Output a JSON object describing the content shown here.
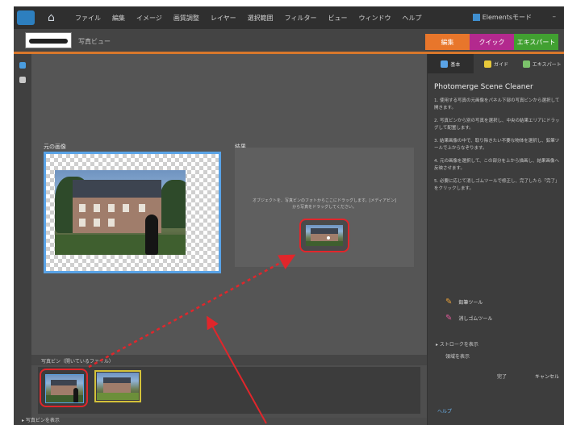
{
  "topbar": {
    "menu": [
      "ファイル",
      "編集",
      "イメージ",
      "画質調整",
      "レイヤー",
      "選択範囲",
      "フィルター",
      "ビュー",
      "ウィンドウ",
      "ヘルプ"
    ],
    "user_button": "Elementsモード"
  },
  "subbar": {
    "project_name": "写真ビュー",
    "mode_tabs": [
      {
        "label": "編集",
        "color": "#e8762b"
      },
      {
        "label": "クイック",
        "color": "#b3298e"
      },
      {
        "label": "エキスパート",
        "color": "#41a031"
      }
    ]
  },
  "canvas": {
    "original_label": "元の画像",
    "result_label": "結果",
    "result_text": "オブジェクトを、写真ビンのフォトからここにドラッグします。[メディアビン] から写真をドラッグしてください。"
  },
  "tray": {
    "label": "写真ビン（開いているファイル）",
    "status": "写真ビンを表示"
  },
  "sidebar": {
    "tabs": [
      {
        "label": "基本",
        "icon_color": "#5aa3e6"
      },
      {
        "label": "ガイド",
        "icon_color": "#e8c93a"
      },
      {
        "label": "エキスパート",
        "icon_color": "#7cc26b"
      }
    ],
    "title": "Photomerge Scene Cleaner",
    "paragraphs": [
      "1. 使用する写真の元画像をパネル下部の写真ビンから選択して開きます。",
      "2. 写真ビンから別の写真を選択し、中央の結果エリアにドラッグして配置します。",
      "3. 結果画像の中で、取り除きたい不要な物体を選択し、鉛筆ツールで上からなぞります。",
      "4. 元の画像を選択して、この部分を上から描画し、結果画像へ反映させます。",
      "5. 必要に応じて消しゴムツールで修正し、完了したら「完了」をクリックします。"
    ],
    "tools": [
      {
        "label": "鉛筆ツール",
        "icon": "pencil-icon",
        "color": "#e8a03a"
      },
      {
        "label": "消しゴムツール",
        "icon": "eraser-icon",
        "color": "#e05a9a"
      }
    ],
    "show_strokes": "ストロークを表示",
    "show_regions": "領域を表示",
    "done_button": "完了",
    "cancel_button": "キャンセル",
    "footer": "ヘルプ"
  }
}
